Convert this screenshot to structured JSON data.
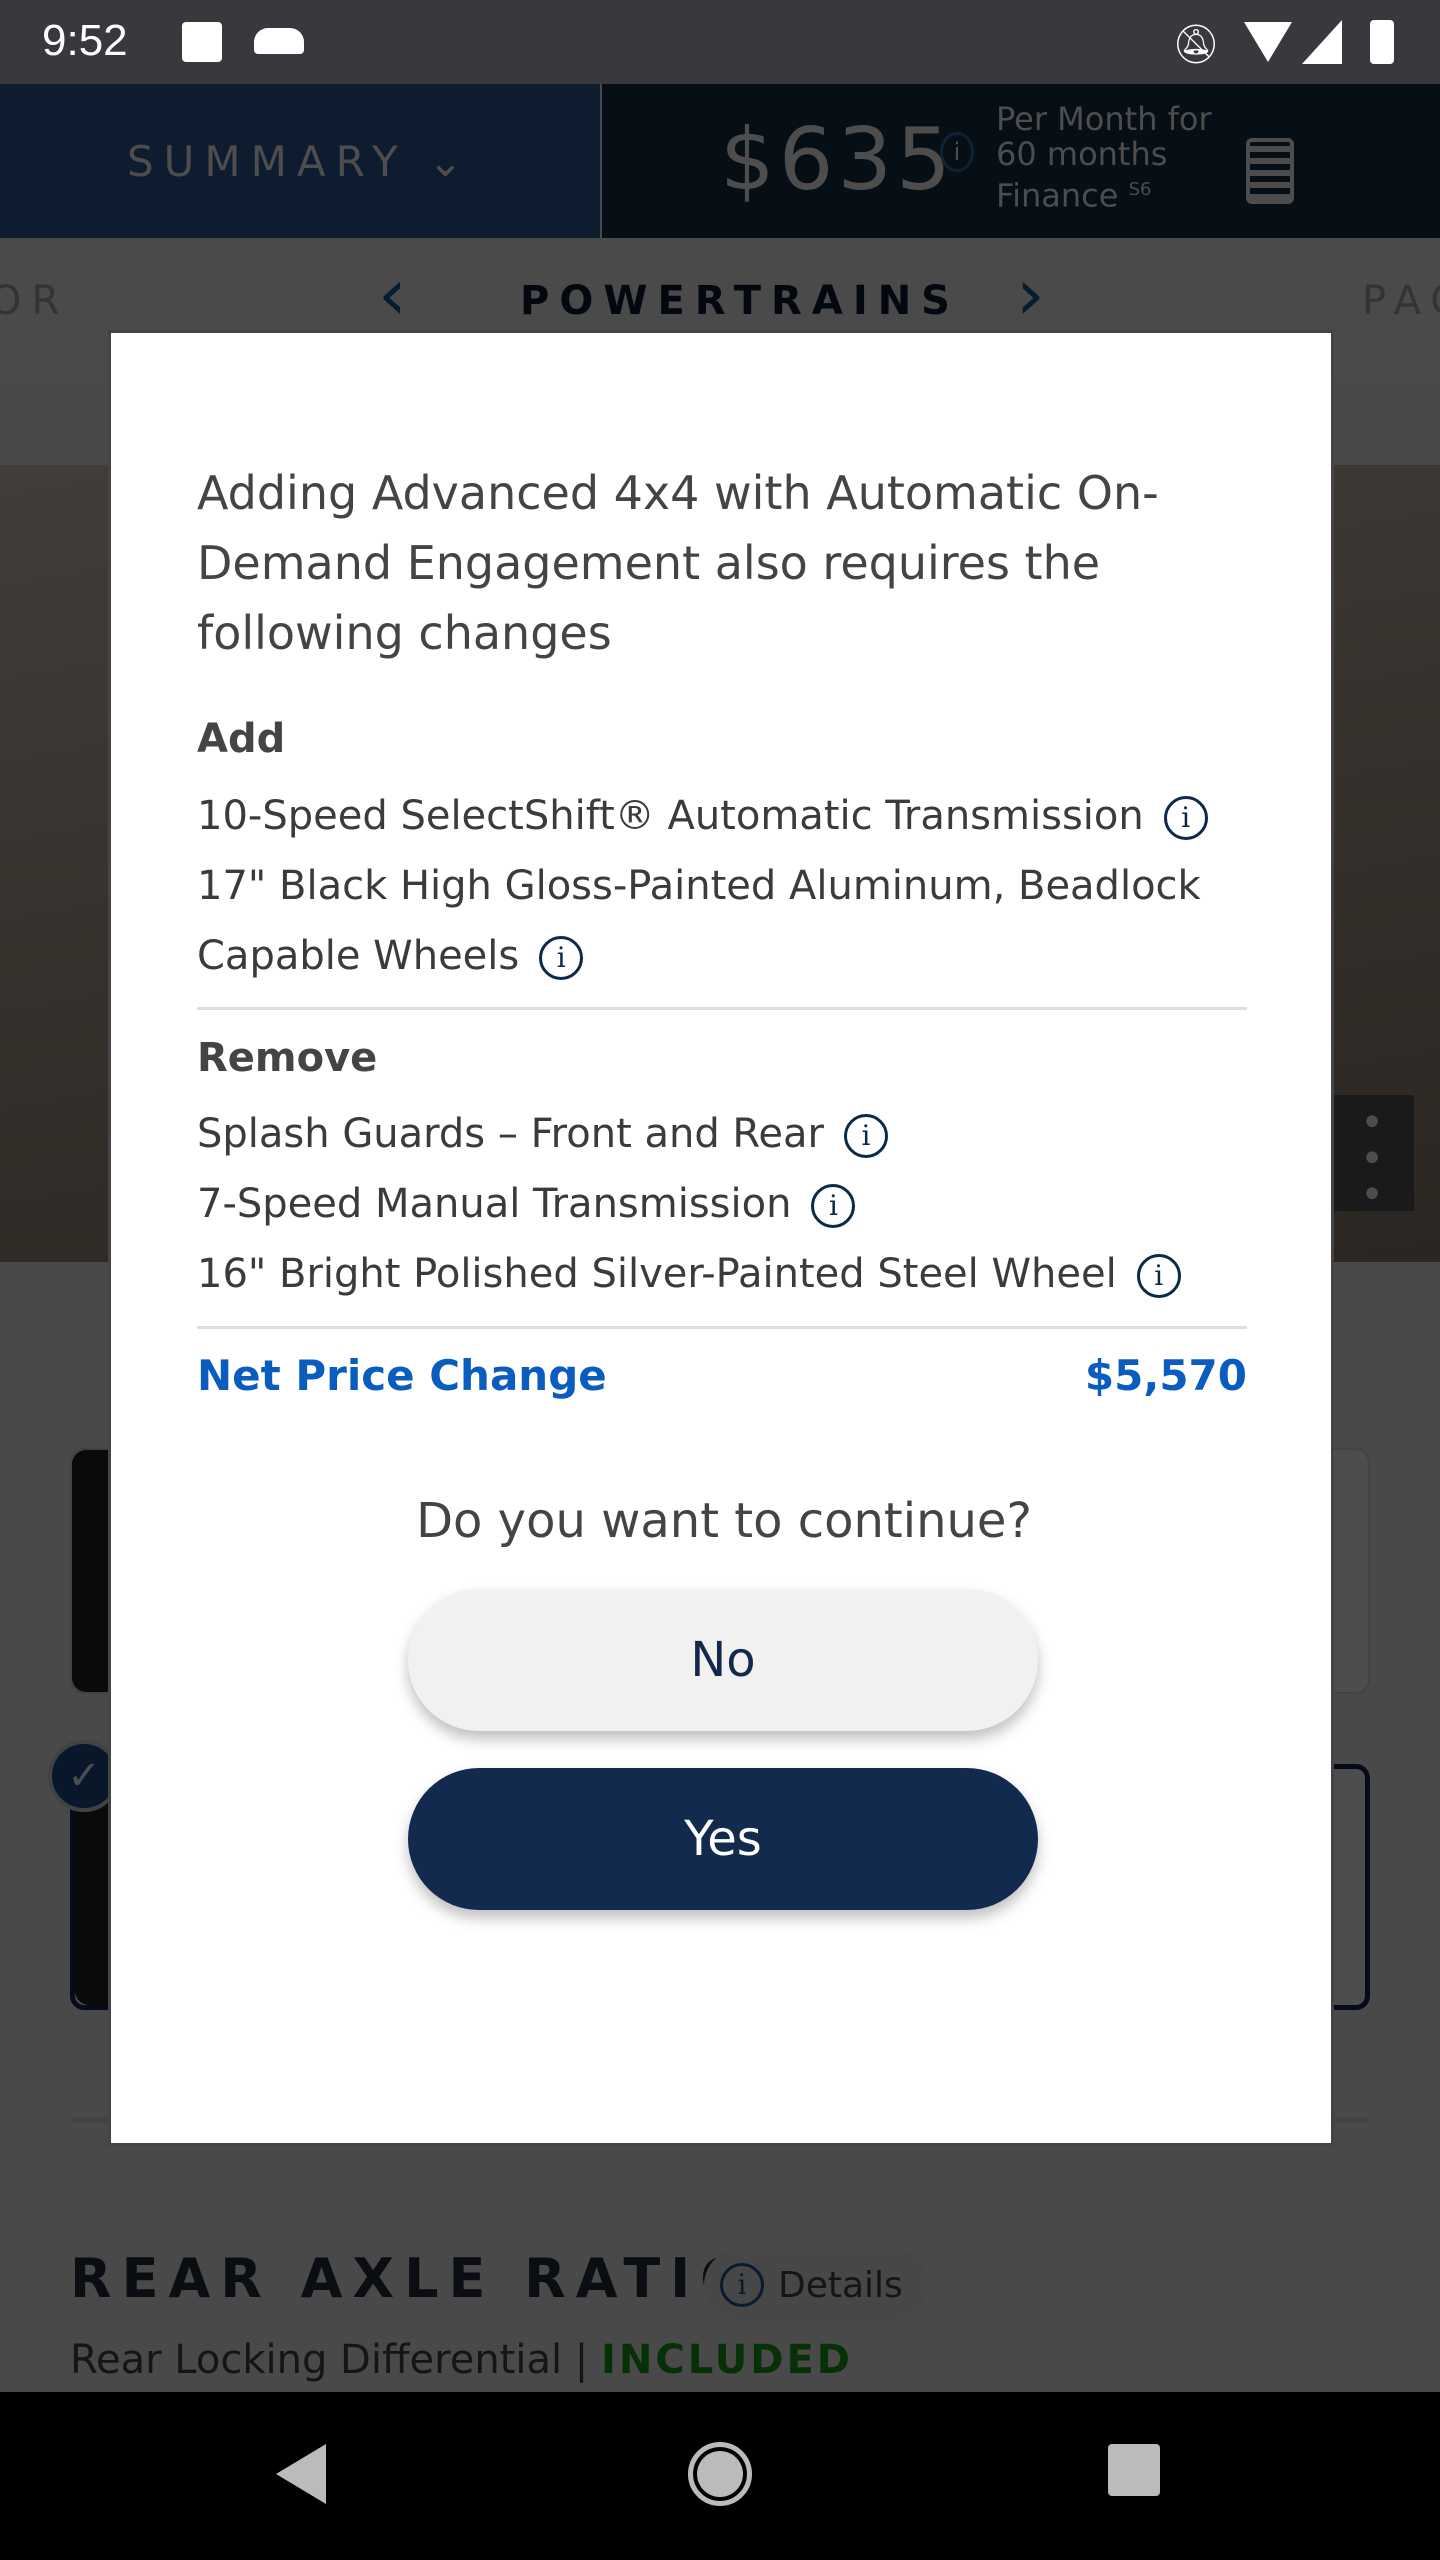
{
  "status_bar": {
    "time": "9:52"
  },
  "header": {
    "summary_label": "SUMMARY",
    "price": "$635",
    "price_note_line1": "Per Month for",
    "price_note_line2": "60 months",
    "price_note_line3": "Finance",
    "footnote": "S6"
  },
  "tabs": {
    "prev_partial": "OR",
    "current": "POWERTRAINS",
    "next_partial": "PAC"
  },
  "background": {
    "section_title": "REAR AXLE RATIO",
    "details_label": "Details",
    "subtitle": "Rear Locking Differential |",
    "subtitle_status": "INCLUDED"
  },
  "modal": {
    "title": "Adding Advanced 4x4 with Automatic On-Demand Engagement also requires the following changes",
    "add_heading": "Add",
    "add_items": [
      "10-Speed SelectShift® Automatic Transmission",
      "17\" Black High Gloss-Painted Aluminum, Beadlock Capable Wheels"
    ],
    "remove_heading": "Remove",
    "remove_items": [
      "Splash Guards – Front and Rear",
      "7-Speed Manual Transmission",
      "16\" Bright Polished Silver-Painted Steel Wheel"
    ],
    "net_label": "Net Price Change",
    "net_value": "$5,570",
    "question": "Do you want to continue?",
    "no_label": "No",
    "yes_label": "Yes"
  },
  "colors": {
    "accent": "#0a5cbf",
    "primary_button": "#122a4d",
    "included": "#008a00"
  }
}
